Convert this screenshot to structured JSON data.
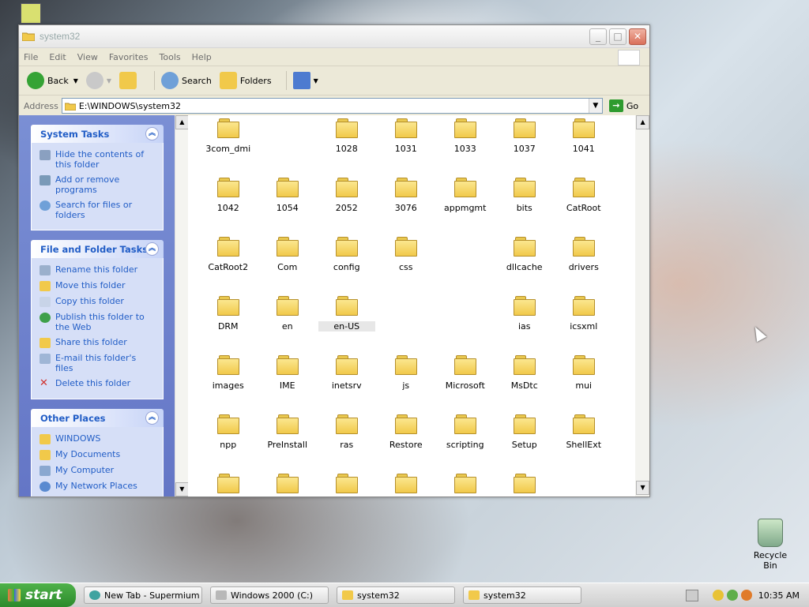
{
  "window": {
    "title": "system32",
    "min": "_",
    "max": "□",
    "close": "✕"
  },
  "menu": [
    "File",
    "Edit",
    "View",
    "Favorites",
    "Tools",
    "Help"
  ],
  "toolbar": {
    "back": "Back",
    "search": "Search",
    "folders": "Folders"
  },
  "address": {
    "label": "Address",
    "value": "E:\\WINDOWS\\system32",
    "go": "Go"
  },
  "system_tasks": {
    "title": "System Tasks",
    "items": [
      "Hide the contents of this folder",
      "Add or remove programs",
      "Search for files or folders"
    ]
  },
  "file_tasks": {
    "title": "File and Folder Tasks",
    "items": [
      "Rename this folder",
      "Move this folder",
      "Copy this folder",
      "Publish this folder to the Web",
      "Share this folder",
      "E-mail this folder's files",
      "Delete this folder"
    ]
  },
  "other_places": {
    "title": "Other Places",
    "items": [
      "WINDOWS",
      "My Documents",
      "My Computer",
      "My Network Places"
    ]
  },
  "files": [
    {
      "name": "3com_dmi",
      "col": 0,
      "row": 0
    },
    {
      "name": "1028",
      "col": 2,
      "row": 0
    },
    {
      "name": "1031",
      "col": 3,
      "row": 0
    },
    {
      "name": "1033",
      "col": 4,
      "row": 0
    },
    {
      "name": "1037",
      "col": 5,
      "row": 0
    },
    {
      "name": "1041",
      "col": 6,
      "row": 0
    },
    {
      "name": "1042",
      "col": 0,
      "row": 1
    },
    {
      "name": "1054",
      "col": 1,
      "row": 1
    },
    {
      "name": "2052",
      "col": 2,
      "row": 1
    },
    {
      "name": "3076",
      "col": 3,
      "row": 1
    },
    {
      "name": "appmgmt",
      "col": 4,
      "row": 1
    },
    {
      "name": "bits",
      "col": 5,
      "row": 1
    },
    {
      "name": "CatRoot",
      "col": 6,
      "row": 1
    },
    {
      "name": "CatRoot2",
      "col": 0,
      "row": 2
    },
    {
      "name": "Com",
      "col": 1,
      "row": 2
    },
    {
      "name": "config",
      "col": 2,
      "row": 2
    },
    {
      "name": "css",
      "col": 3,
      "row": 2
    },
    {
      "name": "dllcache",
      "col": 5,
      "row": 2
    },
    {
      "name": "drivers",
      "col": 6,
      "row": 2
    },
    {
      "name": "DRM",
      "col": 0,
      "row": 3
    },
    {
      "name": "en",
      "col": 1,
      "row": 3
    },
    {
      "name": "en-US",
      "col": 2,
      "row": 3,
      "selected": true
    },
    {
      "name": "ias",
      "col": 5,
      "row": 3
    },
    {
      "name": "icsxml",
      "col": 6,
      "row": 3
    },
    {
      "name": "images",
      "col": 0,
      "row": 4
    },
    {
      "name": "IME",
      "col": 1,
      "row": 4
    },
    {
      "name": "inetsrv",
      "col": 2,
      "row": 4
    },
    {
      "name": "js",
      "col": 3,
      "row": 4
    },
    {
      "name": "Microsoft",
      "col": 4,
      "row": 4
    },
    {
      "name": "MsDtc",
      "col": 5,
      "row": 4
    },
    {
      "name": "mui",
      "col": 6,
      "row": 4
    },
    {
      "name": "npp",
      "col": 0,
      "row": 5
    },
    {
      "name": "PreInstall",
      "col": 1,
      "row": 5
    },
    {
      "name": "ras",
      "col": 2,
      "row": 5
    },
    {
      "name": "Restore",
      "col": 3,
      "row": 5
    },
    {
      "name": "scripting",
      "col": 4,
      "row": 5
    },
    {
      "name": "Setup",
      "col": 5,
      "row": 5
    },
    {
      "name": "ShellExt",
      "col": 6,
      "row": 5
    },
    {
      "name": "",
      "col": 0,
      "row": 6
    },
    {
      "name": "",
      "col": 1,
      "row": 6
    },
    {
      "name": "",
      "col": 2,
      "row": 6
    },
    {
      "name": "",
      "col": 3,
      "row": 6
    },
    {
      "name": "",
      "col": 4,
      "row": 6
    },
    {
      "name": "",
      "col": 5,
      "row": 6
    }
  ],
  "desktop": {
    "recycle_bin": "Recycle Bin"
  },
  "taskbar": {
    "start": "start",
    "buttons": [
      "New Tab - Supermium",
      "Windows 2000 (C:)",
      "system32",
      "system32"
    ],
    "clock": "10:35 AM"
  }
}
